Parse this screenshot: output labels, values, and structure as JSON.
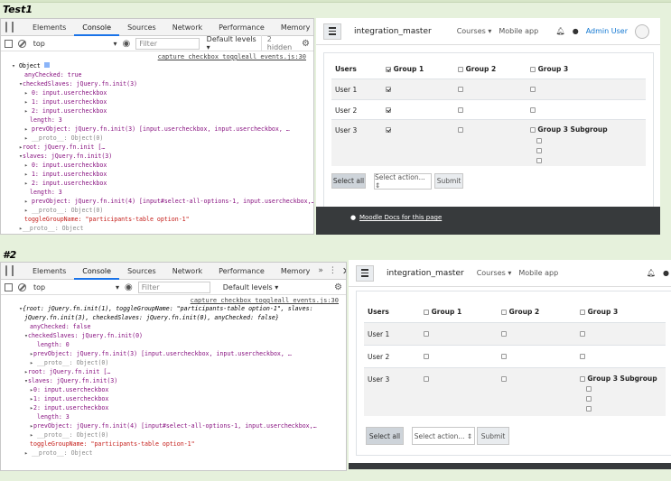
{
  "sections": [
    {
      "label": "Test1"
    },
    {
      "label": "#2"
    }
  ],
  "devtools": {
    "tabs": [
      "Elements",
      "Console",
      "Sources",
      "Network",
      "Performance",
      "Memory"
    ],
    "more": "»",
    "menu": "⋮",
    "close": "✕",
    "context": "top",
    "context_arrow": "▾",
    "filter_placeholder": "Filter",
    "levels": "Default levels ▾",
    "hidden": "2 hidden",
    "source_link": "capture_checkbox_toggleall_events.js:30"
  },
  "console1": [
    "Object",
    "anyChecked: true",
    "checkedSlaves: jQuery.fn.init(3)",
    "0: input.usercheckbox",
    "1: input.usercheckbox",
    "2: input.usercheckbox",
    "length: 3",
    "prevObject: jQuery.fn.init(3) [input.usercheckbox, input.usercheckbox, …",
    "__proto__: Object(0)",
    "root: jQuery.fn.init […",
    "slaves: jQuery.fn.init(3)",
    "0: input.usercheckbox",
    "1: input.usercheckbox",
    "2: input.usercheckbox",
    "length: 3",
    "prevObject: jQuery.fn.init(4) [input#select-all-options-1, input.usercheckbox,…",
    "__proto__: Object(0)",
    "toggleGroupName: \"participants-table option-1\"",
    "__proto__: Object"
  ],
  "console2": [
    "{root: jQuery.fn.init(1), toggleGroupName: \"participants-table option-1\", slaves:",
    "jQuery.fn.init(3), checkedSlaves: jQuery.fn.init(0), anyChecked: false}",
    "anyChecked: false",
    "checkedSlaves: jQuery.fn.init(0)",
    "length: 0",
    "prevObject: jQuery.fn.init(3) [input.usercheckbox, input.usercheckbox, …",
    "__proto__: Object(0)",
    "root: jQuery.fn.init […",
    "slaves: jQuery.fn.init(3)",
    "0: input.usercheckbox",
    "1: input.usercheckbox",
    "2: input.usercheckbox",
    "length: 3",
    "prevObject: jQuery.fn.init(4) [input#select-all-options-1, input.usercheckbox,…",
    "__proto__: Object(0)",
    "toggleGroupName: \"participants-table option-1\"",
    "__proto__: Object"
  ],
  "moodle": {
    "site": "integration_master",
    "courses": "Courses ▾",
    "mobile": "Mobile app",
    "user": "Admin User",
    "headers": [
      "Users",
      "Group 1",
      "Group 2",
      "Group 3"
    ],
    "rows": [
      "User 1",
      "User 2",
      "User 3"
    ],
    "subgroup": "Group 3 Subgroup",
    "select_all": "Select all",
    "select_action": "Select action... ⇕",
    "submit": "Submit",
    "docs": "Moodle Docs for this page"
  }
}
